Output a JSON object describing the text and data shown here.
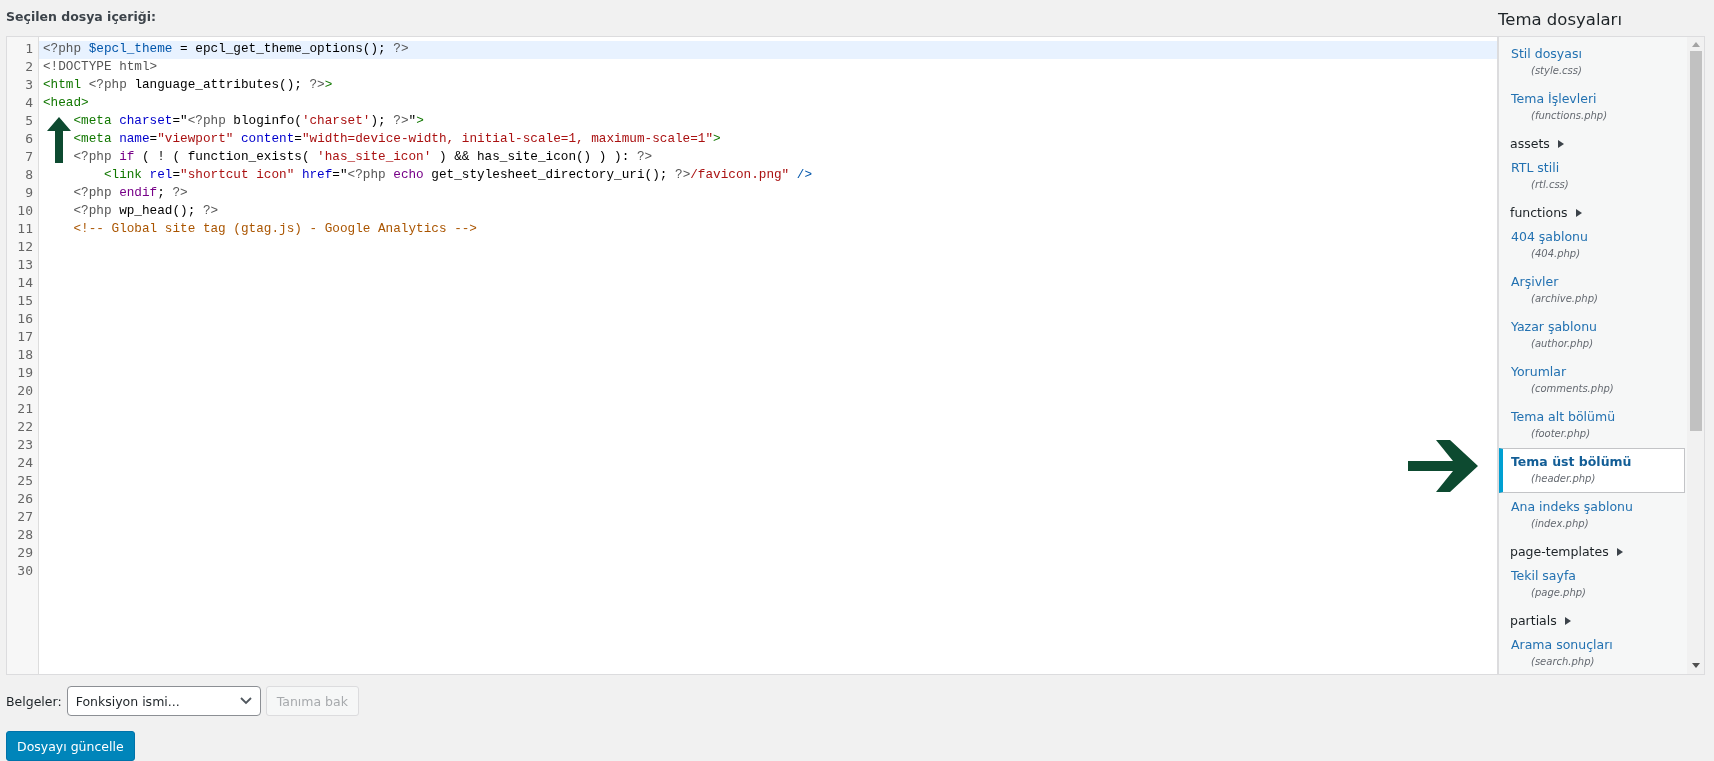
{
  "editor": {
    "label": "Seçilen dosya içeriği:",
    "lines": [
      {
        "number": "1",
        "active": true,
        "tokens": [
          {
            "kind": "php",
            "text": "<?php "
          },
          {
            "kind": "var",
            "text": "$epcl_theme"
          },
          {
            "kind": "plain",
            "text": " = epcl_get_theme_options(); "
          },
          {
            "kind": "php",
            "text": "?>"
          }
        ]
      },
      {
        "number": "2",
        "active": false,
        "tokens": [
          {
            "kind": "php",
            "text": "<!DOCTYPE html>"
          }
        ]
      },
      {
        "number": "3",
        "active": false,
        "tokens": [
          {
            "kind": "tag",
            "text": "<html "
          },
          {
            "kind": "php",
            "text": "<?php "
          },
          {
            "kind": "plain",
            "text": "language_attributes(); "
          },
          {
            "kind": "php",
            "text": "?>"
          },
          {
            "kind": "tag",
            "text": ">"
          }
        ]
      },
      {
        "number": "4",
        "active": false,
        "tokens": [
          {
            "kind": "tag",
            "text": "<head>"
          }
        ]
      },
      {
        "number": "5",
        "active": false,
        "tokens": [
          {
            "kind": "tag",
            "text": "    <meta "
          },
          {
            "kind": "attr",
            "text": "charset"
          },
          {
            "kind": "plain",
            "text": "=\""
          },
          {
            "kind": "php",
            "text": "<?php "
          },
          {
            "kind": "plain",
            "text": "bloginfo("
          },
          {
            "kind": "string",
            "text": "'charset'"
          },
          {
            "kind": "plain",
            "text": "); "
          },
          {
            "kind": "php",
            "text": "?>"
          },
          {
            "kind": "plain",
            "text": "\""
          },
          {
            "kind": "tag",
            "text": ">"
          }
        ]
      },
      {
        "number": "6",
        "active": false,
        "tokens": [
          {
            "kind": "tag",
            "text": "    <meta "
          },
          {
            "kind": "attr",
            "text": "name"
          },
          {
            "kind": "plain",
            "text": "="
          },
          {
            "kind": "string",
            "text": "\"viewport\" "
          },
          {
            "kind": "attr",
            "text": "content"
          },
          {
            "kind": "plain",
            "text": "="
          },
          {
            "kind": "string",
            "text": "\"width=device-width, initial-scale=1, maximum-scale=1\""
          },
          {
            "kind": "tag",
            "text": ">"
          }
        ]
      },
      {
        "number": "7",
        "active": false,
        "tokens": [
          {
            "kind": "php",
            "text": "    <?php "
          },
          {
            "kind": "keyword",
            "text": "if"
          },
          {
            "kind": "plain",
            "text": " ( ! ( function_exists( "
          },
          {
            "kind": "string",
            "text": "'has_site_icon'"
          },
          {
            "kind": "plain",
            "text": " ) && has_site_icon() ) ): "
          },
          {
            "kind": "php",
            "text": "?>"
          }
        ]
      },
      {
        "number": "8",
        "active": false,
        "tokens": [
          {
            "kind": "tag",
            "text": "        <link "
          },
          {
            "kind": "attr",
            "text": "rel"
          },
          {
            "kind": "plain",
            "text": "="
          },
          {
            "kind": "string",
            "text": "\"shortcut icon\" "
          },
          {
            "kind": "attr",
            "text": "href"
          },
          {
            "kind": "plain",
            "text": "=\""
          },
          {
            "kind": "php",
            "text": "<?php "
          },
          {
            "kind": "keyword",
            "text": "echo"
          },
          {
            "kind": "plain",
            "text": " get_stylesheet_directory_uri(); "
          },
          {
            "kind": "php",
            "text": "?>"
          },
          {
            "kind": "string",
            "text": "/favicon.png\" "
          },
          {
            "kind": "var",
            "text": "/>"
          }
        ]
      },
      {
        "number": "9",
        "active": false,
        "tokens": [
          {
            "kind": "php",
            "text": "    <?php "
          },
          {
            "kind": "keyword",
            "text": "endif"
          },
          {
            "kind": "plain",
            "text": "; "
          },
          {
            "kind": "php",
            "text": "?>"
          }
        ]
      },
      {
        "number": "10",
        "active": false,
        "tokens": [
          {
            "kind": "php",
            "text": "    <?php "
          },
          {
            "kind": "plain",
            "text": "wp_head(); "
          },
          {
            "kind": "php",
            "text": "?>"
          }
        ]
      },
      {
        "number": "11",
        "active": false,
        "tokens": [
          {
            "kind": "comment",
            "text": "    <!-- Global site tag (gtag.js) - Google Analytics -->"
          }
        ]
      },
      {
        "number": "12",
        "active": false
      },
      {
        "number": "13",
        "active": false
      },
      {
        "number": "14",
        "active": false
      },
      {
        "number": "15",
        "active": false
      },
      {
        "number": "16",
        "active": false
      },
      {
        "number": "17",
        "active": false
      },
      {
        "number": "18",
        "active": false
      },
      {
        "number": "19",
        "active": false
      },
      {
        "number": "20",
        "active": false
      },
      {
        "number": "21",
        "active": false
      },
      {
        "number": "22",
        "active": false
      },
      {
        "number": "23",
        "active": false
      },
      {
        "number": "24",
        "active": false
      },
      {
        "number": "25",
        "active": false
      },
      {
        "number": "26",
        "active": false
      },
      {
        "number": "27",
        "active": false
      },
      {
        "number": "28",
        "active": false
      },
      {
        "number": "29",
        "active": false
      },
      {
        "number": "30",
        "active": false
      }
    ]
  },
  "sidebar": {
    "title": "Tema dosyaları",
    "items": [
      {
        "kind": "file",
        "label": "Stil dosyası",
        "file": "(style.css)",
        "selected": false
      },
      {
        "kind": "file",
        "label": "Tema İşlevleri",
        "file": "(functions.php)",
        "selected": false
      },
      {
        "kind": "folder",
        "label": "assets",
        "expanded": false
      },
      {
        "kind": "file",
        "label": "RTL stili",
        "file": "(rtl.css)",
        "selected": false
      },
      {
        "kind": "folder",
        "label": "functions",
        "expanded": false
      },
      {
        "kind": "file",
        "label": "404 şablonu",
        "file": "(404.php)",
        "selected": false
      },
      {
        "kind": "file",
        "label": "Arşivler",
        "file": "(archive.php)",
        "selected": false
      },
      {
        "kind": "file",
        "label": "Yazar şablonu",
        "file": "(author.php)",
        "selected": false
      },
      {
        "kind": "file",
        "label": "Yorumlar",
        "file": "(comments.php)",
        "selected": false
      },
      {
        "kind": "file",
        "label": "Tema alt bölümü",
        "file": "(footer.php)",
        "selected": false
      },
      {
        "kind": "file",
        "label": "Tema üst bölümü",
        "file": "(header.php)",
        "selected": true
      },
      {
        "kind": "file",
        "label": "Ana indeks şablonu",
        "file": "(index.php)",
        "selected": false
      },
      {
        "kind": "folder",
        "label": "page-templates",
        "expanded": false
      },
      {
        "kind": "file",
        "label": "Tekil sayfa",
        "file": "(page.php)",
        "selected": false
      },
      {
        "kind": "folder",
        "label": "partials",
        "expanded": false
      },
      {
        "kind": "file",
        "label": "Arama sonuçları",
        "file": "(search.php)",
        "selected": false
      }
    ]
  },
  "docs": {
    "label": "Belgeler:",
    "select_value": "Fonksiyon ismi...",
    "lookup_button": {
      "label": "Tanıma bak",
      "disabled": true
    }
  },
  "update_button": "Dosyayı güncelle"
}
